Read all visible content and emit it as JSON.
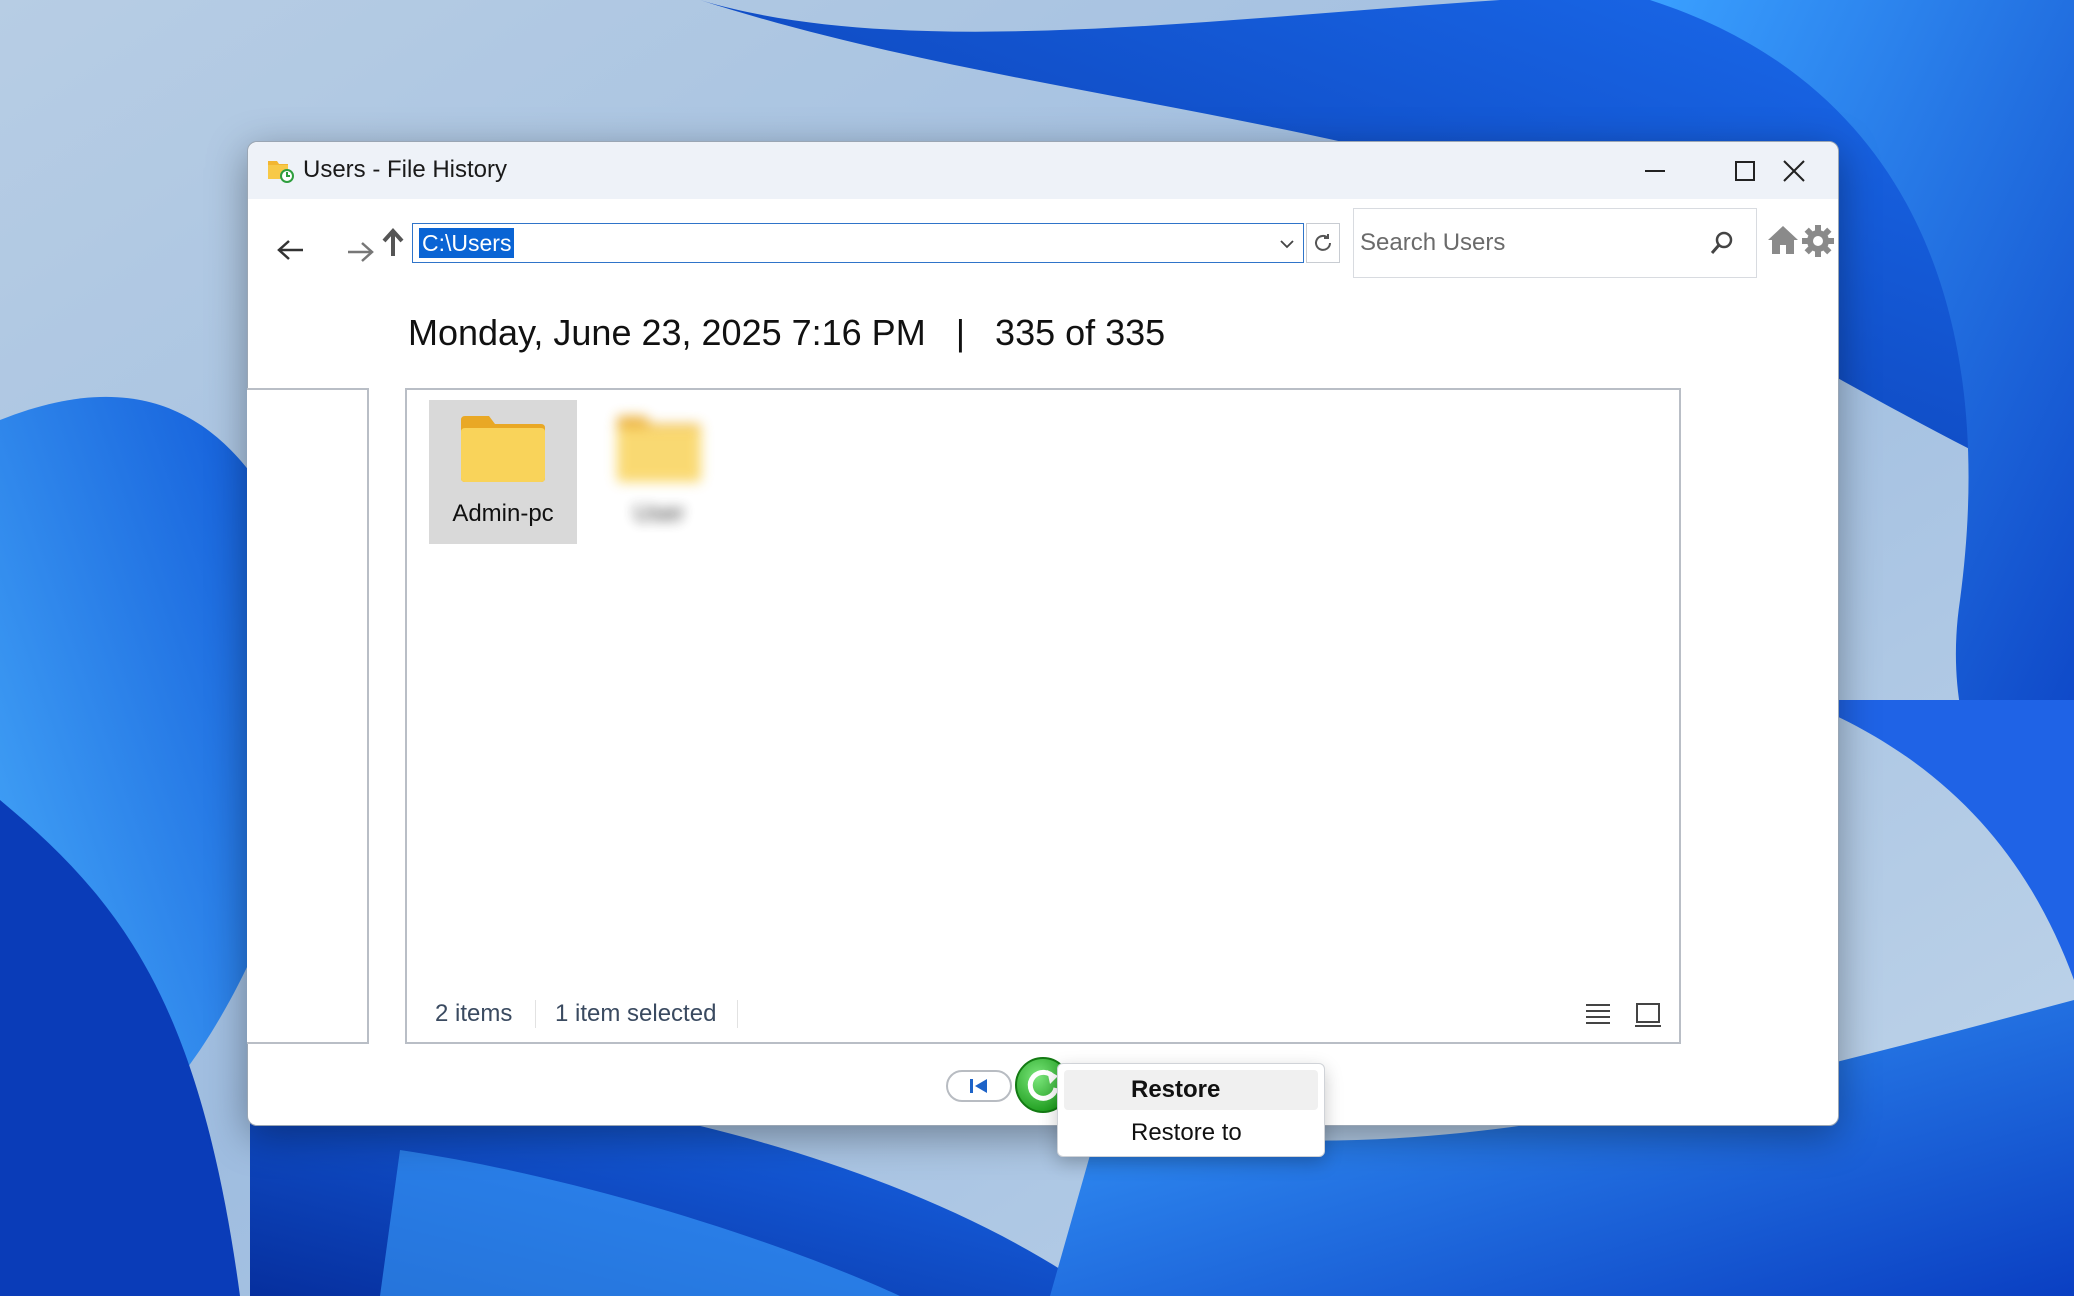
{
  "window": {
    "title": "Users - File History"
  },
  "toolbar": {
    "address": "C:\\Users",
    "search_placeholder": "Search Users"
  },
  "header": {
    "date": "Monday, June 23, 2025 7:16 PM",
    "separator": "|",
    "version": "335 of 335"
  },
  "files": [
    {
      "name": "Admin-pc",
      "selected": true,
      "blurred": false
    },
    {
      "name": "User",
      "selected": false,
      "blurred": true
    }
  ],
  "status": {
    "item_count": "2 items",
    "selection": "1 item selected"
  },
  "context_menu": {
    "items": [
      "Restore",
      "Restore to"
    ]
  },
  "colors": {
    "accent": "#0a64d4",
    "folder": "#f7c948",
    "restore_green": "#2eb82e"
  }
}
